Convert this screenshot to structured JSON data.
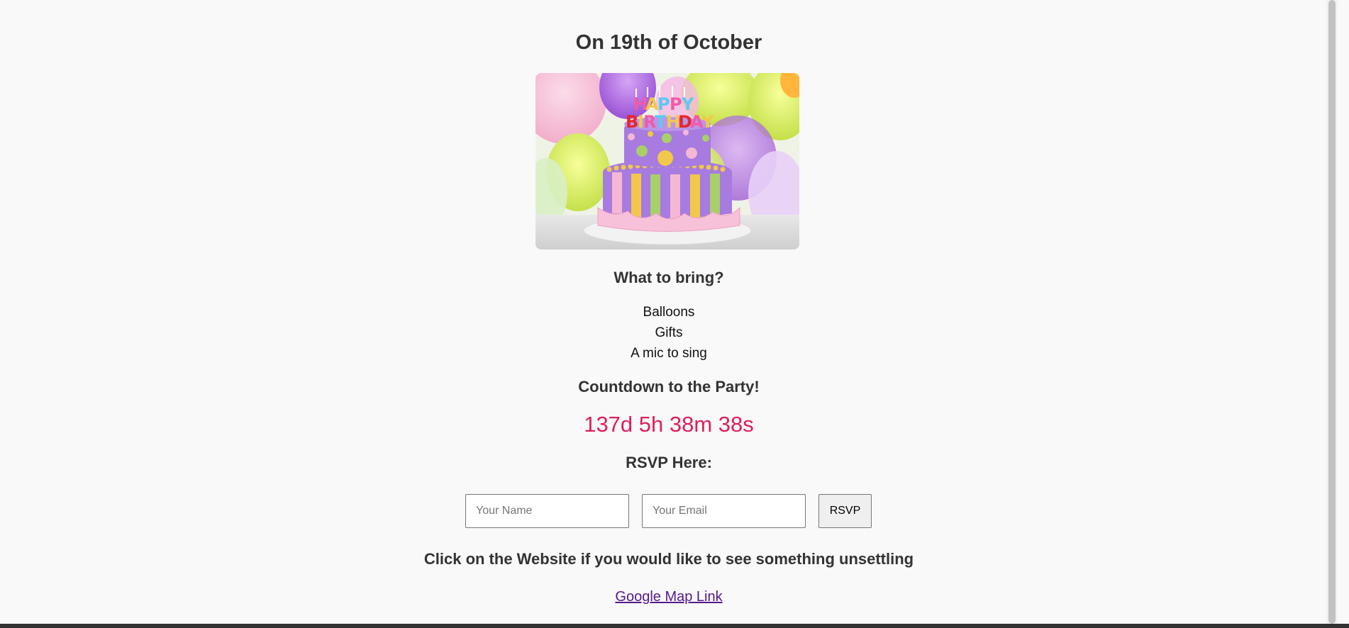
{
  "event": {
    "title": "On 19th of October",
    "image_alt": "Birthday cake",
    "cake_topper_text": "HAPPY BIRTHDAY"
  },
  "bring": {
    "heading": "What to bring?",
    "items": [
      "Balloons",
      "Gifts",
      "A mic to sing"
    ]
  },
  "countdown": {
    "heading": "Countdown to the Party!",
    "value": "137d 5h 38m 38s",
    "color": "#e01e5a"
  },
  "rsvp": {
    "heading": "RSVP Here:",
    "name_placeholder": "Your Name",
    "email_placeholder": "Your Email",
    "name_value": "",
    "email_value": "",
    "button_label": "RSVP"
  },
  "website": {
    "heading": "Click on the Website if you would like to see something unsettling",
    "link_label": "Google Map Link",
    "link_color": "#551a8b"
  },
  "colors": {
    "background": "#f9f9f9",
    "text": "#333333",
    "footer": "#333333"
  }
}
